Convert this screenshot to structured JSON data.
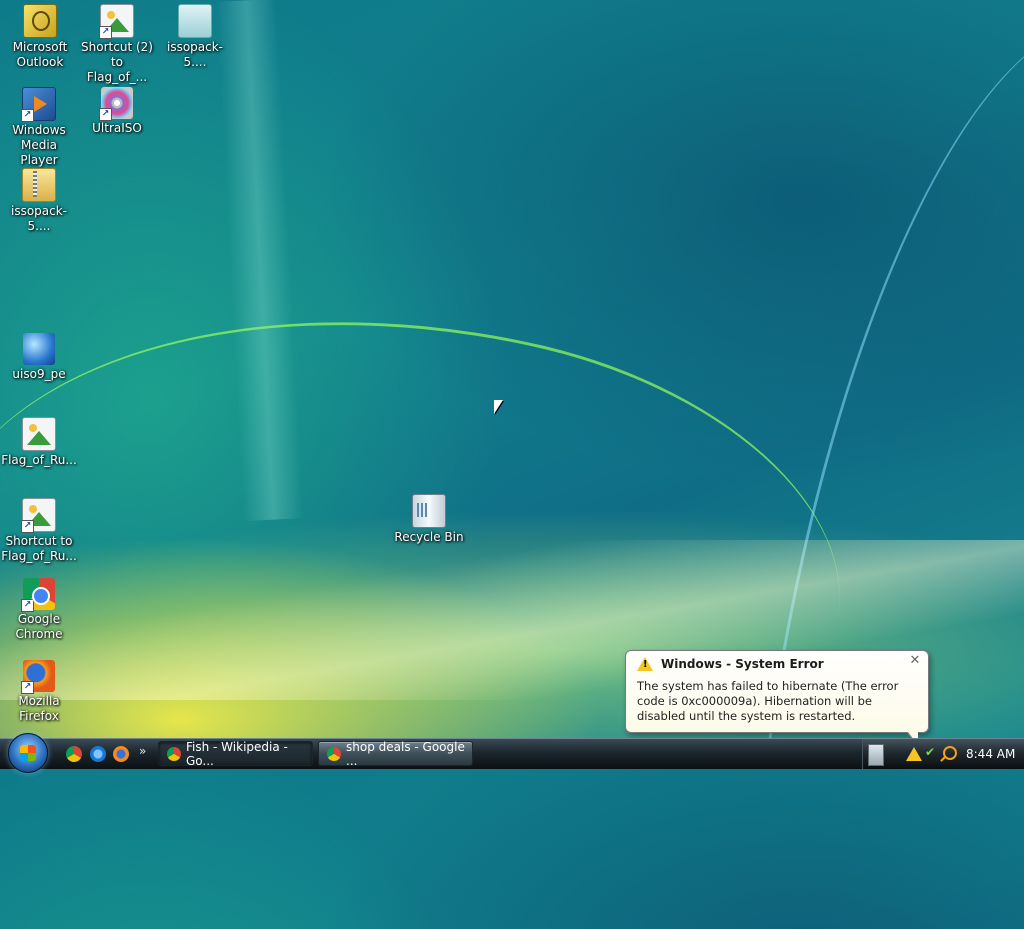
{
  "desktop": {
    "icons": [
      {
        "label_line1": "Microsoft",
        "label_line2": "Outlook",
        "icon": "outlook-icon"
      },
      {
        "label_line1": "Shortcut (2)",
        "label_line2": "to Flag_of_...",
        "icon": "image-shortcut-icon"
      },
      {
        "label_line1": "issopack-5....",
        "label_line2": "",
        "icon": "file-icon"
      },
      {
        "label_line1": "Windows",
        "label_line2": "Media Player",
        "icon": "media-player-icon"
      },
      {
        "label_line1": "UltraISO",
        "label_line2": "",
        "icon": "disc-icon"
      },
      {
        "label_line1": "issopack-5....",
        "label_line2": "",
        "icon": "zip-folder-icon"
      },
      {
        "label_line1": "uiso9_pe",
        "label_line2": "",
        "icon": "globe-installer-icon"
      },
      {
        "label_line1": "Flag_of_Ru...",
        "label_line2": "",
        "icon": "image-icon"
      },
      {
        "label_line1": "Shortcut to",
        "label_line2": "Flag_of_Ru...",
        "icon": "image-shortcut-icon"
      },
      {
        "label_line1": "Google",
        "label_line2": "Chrome",
        "icon": "chrome-icon"
      },
      {
        "label_line1": "Mozilla",
        "label_line2": "Firefox",
        "icon": "firefox-icon"
      },
      {
        "label_line1": "Recycle Bin",
        "label_line2": "",
        "icon": "recycle-bin-icon"
      }
    ]
  },
  "balloon": {
    "title": "Windows - System Error",
    "body": "The system has failed to hibernate (The error code is 0xc000009a).  Hibernation will be disabled until the system is restarted.",
    "close_glyph": "✕"
  },
  "taskbar": {
    "quick_launch_more": "»",
    "buttons": [
      {
        "label": "Fish - Wikipedia - Go...",
        "active": true
      },
      {
        "label": "shop deals - Google ...",
        "active": false
      }
    ],
    "clock": "8:44 AM"
  }
}
